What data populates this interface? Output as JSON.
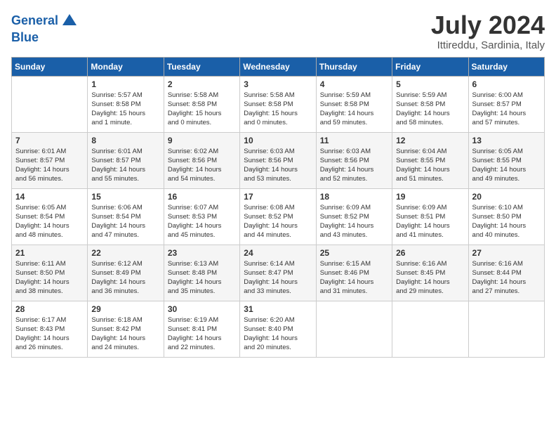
{
  "header": {
    "logo_line1": "General",
    "logo_line2": "Blue",
    "month_title": "July 2024",
    "location": "Ittireddu, Sardinia, Italy"
  },
  "days_of_week": [
    "Sunday",
    "Monday",
    "Tuesday",
    "Wednesday",
    "Thursday",
    "Friday",
    "Saturday"
  ],
  "weeks": [
    [
      {
        "day": "",
        "info": ""
      },
      {
        "day": "1",
        "info": "Sunrise: 5:57 AM\nSunset: 8:58 PM\nDaylight: 15 hours\nand 1 minute."
      },
      {
        "day": "2",
        "info": "Sunrise: 5:58 AM\nSunset: 8:58 PM\nDaylight: 15 hours\nand 0 minutes."
      },
      {
        "day": "3",
        "info": "Sunrise: 5:58 AM\nSunset: 8:58 PM\nDaylight: 15 hours\nand 0 minutes."
      },
      {
        "day": "4",
        "info": "Sunrise: 5:59 AM\nSunset: 8:58 PM\nDaylight: 14 hours\nand 59 minutes."
      },
      {
        "day": "5",
        "info": "Sunrise: 5:59 AM\nSunset: 8:58 PM\nDaylight: 14 hours\nand 58 minutes."
      },
      {
        "day": "6",
        "info": "Sunrise: 6:00 AM\nSunset: 8:57 PM\nDaylight: 14 hours\nand 57 minutes."
      }
    ],
    [
      {
        "day": "7",
        "info": "Sunrise: 6:01 AM\nSunset: 8:57 PM\nDaylight: 14 hours\nand 56 minutes."
      },
      {
        "day": "8",
        "info": "Sunrise: 6:01 AM\nSunset: 8:57 PM\nDaylight: 14 hours\nand 55 minutes."
      },
      {
        "day": "9",
        "info": "Sunrise: 6:02 AM\nSunset: 8:56 PM\nDaylight: 14 hours\nand 54 minutes."
      },
      {
        "day": "10",
        "info": "Sunrise: 6:03 AM\nSunset: 8:56 PM\nDaylight: 14 hours\nand 53 minutes."
      },
      {
        "day": "11",
        "info": "Sunrise: 6:03 AM\nSunset: 8:56 PM\nDaylight: 14 hours\nand 52 minutes."
      },
      {
        "day": "12",
        "info": "Sunrise: 6:04 AM\nSunset: 8:55 PM\nDaylight: 14 hours\nand 51 minutes."
      },
      {
        "day": "13",
        "info": "Sunrise: 6:05 AM\nSunset: 8:55 PM\nDaylight: 14 hours\nand 49 minutes."
      }
    ],
    [
      {
        "day": "14",
        "info": "Sunrise: 6:05 AM\nSunset: 8:54 PM\nDaylight: 14 hours\nand 48 minutes."
      },
      {
        "day": "15",
        "info": "Sunrise: 6:06 AM\nSunset: 8:54 PM\nDaylight: 14 hours\nand 47 minutes."
      },
      {
        "day": "16",
        "info": "Sunrise: 6:07 AM\nSunset: 8:53 PM\nDaylight: 14 hours\nand 45 minutes."
      },
      {
        "day": "17",
        "info": "Sunrise: 6:08 AM\nSunset: 8:52 PM\nDaylight: 14 hours\nand 44 minutes."
      },
      {
        "day": "18",
        "info": "Sunrise: 6:09 AM\nSunset: 8:52 PM\nDaylight: 14 hours\nand 43 minutes."
      },
      {
        "day": "19",
        "info": "Sunrise: 6:09 AM\nSunset: 8:51 PM\nDaylight: 14 hours\nand 41 minutes."
      },
      {
        "day": "20",
        "info": "Sunrise: 6:10 AM\nSunset: 8:50 PM\nDaylight: 14 hours\nand 40 minutes."
      }
    ],
    [
      {
        "day": "21",
        "info": "Sunrise: 6:11 AM\nSunset: 8:50 PM\nDaylight: 14 hours\nand 38 minutes."
      },
      {
        "day": "22",
        "info": "Sunrise: 6:12 AM\nSunset: 8:49 PM\nDaylight: 14 hours\nand 36 minutes."
      },
      {
        "day": "23",
        "info": "Sunrise: 6:13 AM\nSunset: 8:48 PM\nDaylight: 14 hours\nand 35 minutes."
      },
      {
        "day": "24",
        "info": "Sunrise: 6:14 AM\nSunset: 8:47 PM\nDaylight: 14 hours\nand 33 minutes."
      },
      {
        "day": "25",
        "info": "Sunrise: 6:15 AM\nSunset: 8:46 PM\nDaylight: 14 hours\nand 31 minutes."
      },
      {
        "day": "26",
        "info": "Sunrise: 6:16 AM\nSunset: 8:45 PM\nDaylight: 14 hours\nand 29 minutes."
      },
      {
        "day": "27",
        "info": "Sunrise: 6:16 AM\nSunset: 8:44 PM\nDaylight: 14 hours\nand 27 minutes."
      }
    ],
    [
      {
        "day": "28",
        "info": "Sunrise: 6:17 AM\nSunset: 8:43 PM\nDaylight: 14 hours\nand 26 minutes."
      },
      {
        "day": "29",
        "info": "Sunrise: 6:18 AM\nSunset: 8:42 PM\nDaylight: 14 hours\nand 24 minutes."
      },
      {
        "day": "30",
        "info": "Sunrise: 6:19 AM\nSunset: 8:41 PM\nDaylight: 14 hours\nand 22 minutes."
      },
      {
        "day": "31",
        "info": "Sunrise: 6:20 AM\nSunset: 8:40 PM\nDaylight: 14 hours\nand 20 minutes."
      },
      {
        "day": "",
        "info": ""
      },
      {
        "day": "",
        "info": ""
      },
      {
        "day": "",
        "info": ""
      }
    ]
  ]
}
